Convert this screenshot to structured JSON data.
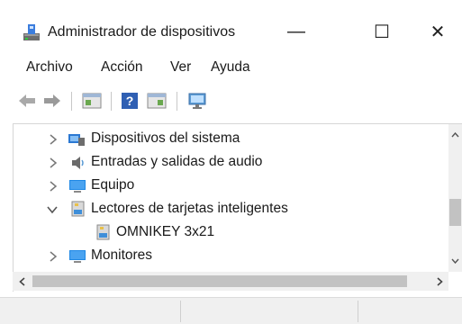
{
  "window": {
    "title": "Administrador de dispositivos",
    "app_icon": "device-manager-icon",
    "controls": {
      "minimize": "—",
      "maximize": "☐",
      "close": "✕"
    }
  },
  "menu": {
    "items": [
      {
        "label": "Archivo"
      },
      {
        "label": "Acción"
      },
      {
        "label": "Ver"
      },
      {
        "label": "Ayuda"
      }
    ]
  },
  "toolbar": {
    "buttons": [
      {
        "icon": "back-arrow-icon"
      },
      {
        "icon": "forward-arrow-icon"
      },
      {
        "icon": "properties-icon"
      },
      {
        "icon": "help-icon"
      },
      {
        "icon": "update-driver-icon"
      },
      {
        "icon": "scan-hardware-icon"
      }
    ]
  },
  "tree": {
    "items": [
      {
        "label": "Dispositivos del sistema",
        "state": "collapsed",
        "icon": "system-devices-icon"
      },
      {
        "label": "Entradas y salidas de audio",
        "state": "collapsed",
        "icon": "speaker-icon"
      },
      {
        "label": "Equipo",
        "state": "collapsed",
        "icon": "monitor-icon"
      },
      {
        "label": "Lectores de tarjetas inteligentes",
        "state": "expanded",
        "icon": "smart-card-reader-icon"
      },
      {
        "label": "OMNIKEY 3x21",
        "state": "leaf",
        "icon": "smart-card-reader-icon"
      },
      {
        "label": "Monitores",
        "state": "collapsed",
        "icon": "monitor-icon"
      }
    ]
  },
  "colors": {
    "accent_blue": "#1e88e5",
    "chevron": "#777777",
    "scroll_track": "#f0f0f0",
    "scroll_thumb": "#c2c2c2"
  }
}
